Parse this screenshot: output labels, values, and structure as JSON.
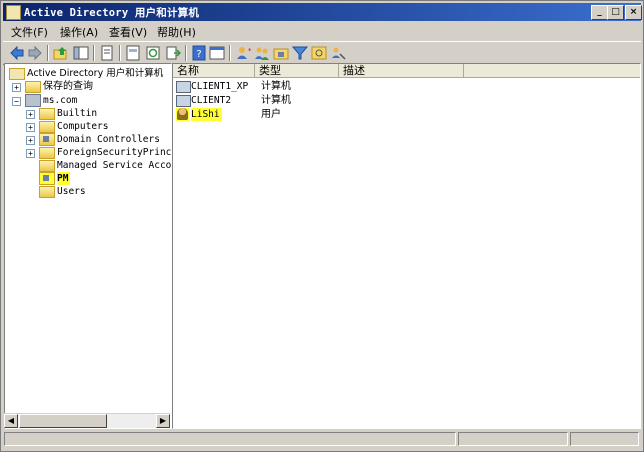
{
  "window": {
    "title": "Active Directory 用户和计算机",
    "controls": [
      "minimize-icon",
      "maximize-icon",
      "close-icon"
    ]
  },
  "menu": [
    "文件(F)",
    "操作(A)",
    "查看(V)",
    "帮助(H)"
  ],
  "toolbar_icons": [
    "back-icon",
    "forward-icon",
    "up-icon",
    "show-tree-icon",
    "copy-icon",
    "properties-icon",
    "refresh-icon",
    "export-icon",
    "help-icon",
    "console-icon",
    "new-user-icon",
    "new-group-icon",
    "new-ou-icon",
    "filter-icon",
    "find-icon",
    "delegate-icon"
  ],
  "tree": {
    "root": "Active Directory 用户和计算机",
    "saved_queries": "保存的查询",
    "domain": "ms.com",
    "children": [
      "Builtin",
      "Computers",
      "Domain Controllers",
      "ForeignSecurityPrincip",
      "Managed Service Accour",
      "PM",
      "Users"
    ],
    "selected": "PM"
  },
  "list": {
    "columns": [
      "名称",
      "类型",
      "描述"
    ],
    "rows": [
      {
        "name": "CLIENT1_XP",
        "type": "计算机",
        "desc": "",
        "icon": "computer-icon"
      },
      {
        "name": "CLIENT2",
        "type": "计算机",
        "desc": "",
        "icon": "computer-icon"
      },
      {
        "name": "LiShi",
        "type": "用户",
        "desc": "",
        "icon": "user-icon",
        "highlighted": true
      }
    ]
  },
  "highlight_color": "#ffff33"
}
